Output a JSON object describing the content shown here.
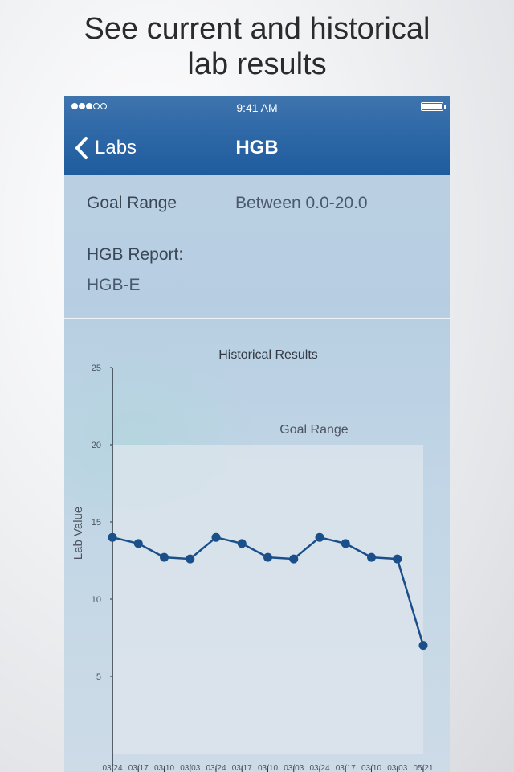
{
  "headline": {
    "line1": "See current and historical",
    "line2": "lab results"
  },
  "status_bar": {
    "time": "9:41 AM",
    "signal_full": 3,
    "signal_empty": 2
  },
  "nav": {
    "back_label": "Labs",
    "title": "HGB"
  },
  "info": {
    "goal_label": "Goal Range",
    "goal_value": "Between 0.0-20.0",
    "report_label": "HGB Report:",
    "report_value": "HGB-E"
  },
  "colors": {
    "nav_bar": "#2d67a6",
    "line": "#1a4f8a",
    "goal_band": "#dfe6ec"
  },
  "chart_data": {
    "type": "line",
    "title": "Historical Results",
    "xlabel": "",
    "ylabel": "Lab Value",
    "ylim": [
      0,
      25
    ],
    "yticks": [
      5,
      10,
      15,
      20,
      25
    ],
    "goal_range": {
      "label": "Goal Range",
      "min": 0,
      "max": 20
    },
    "categories": [
      "03/24",
      "03/17",
      "03/10",
      "03/03",
      "03/24",
      "03/17",
      "03/10",
      "03/03",
      "03/24",
      "03/17",
      "03/10",
      "03/03",
      "05/21"
    ],
    "values": [
      14.0,
      13.6,
      12.7,
      12.6,
      14.0,
      13.6,
      12.7,
      12.6,
      14.0,
      13.6,
      12.7,
      12.6,
      7.0
    ],
    "grid": false
  }
}
